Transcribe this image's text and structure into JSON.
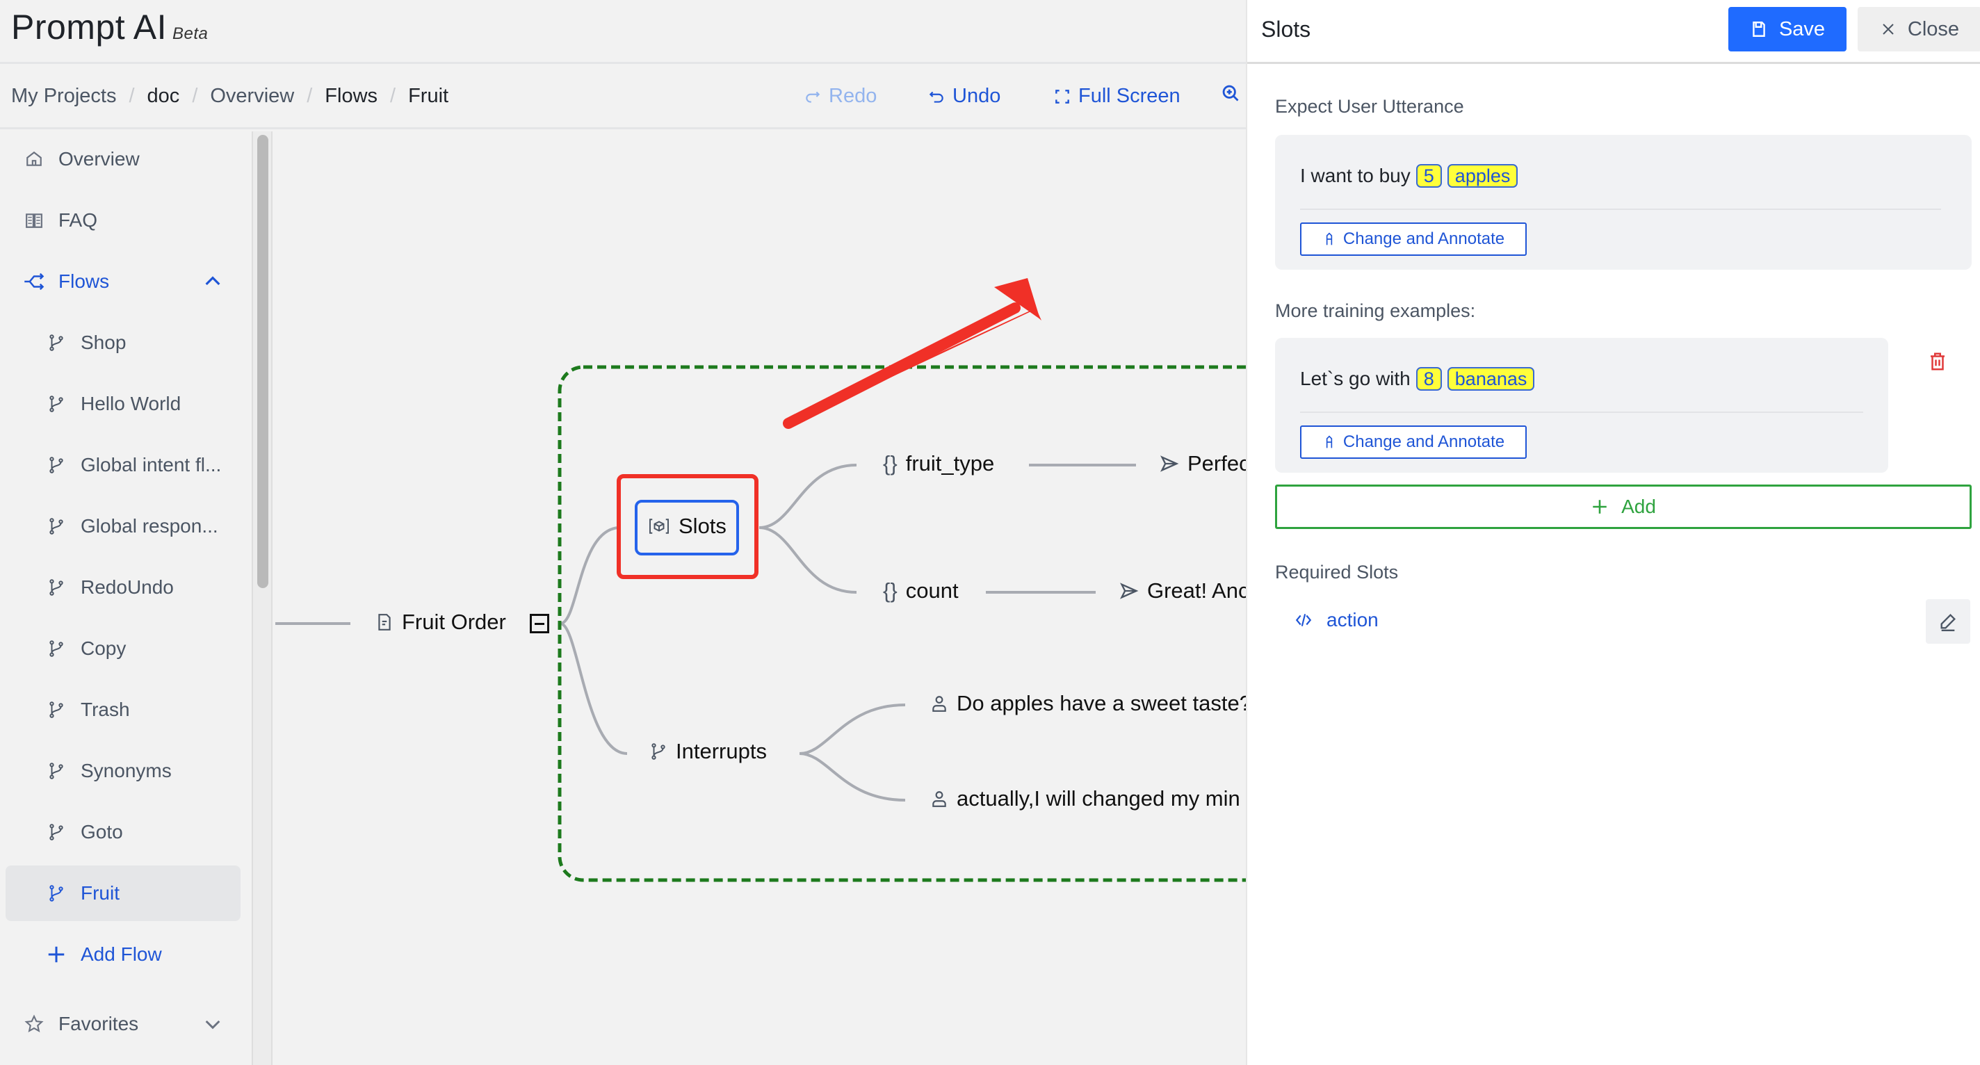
{
  "app": {
    "title": "Prompt AI",
    "badge": "Beta"
  },
  "breadcrumb": [
    "My Projects",
    "doc",
    "Overview",
    "Flows",
    "Fruit"
  ],
  "toolbar": {
    "redo": "Redo",
    "undo": "Undo",
    "fullscreen": "Full Screen",
    "zoom_icon": "zoom-in-icon"
  },
  "sidebar": {
    "overview": "Overview",
    "faq": "FAQ",
    "flows": "Flows",
    "flow_items": [
      "Shop",
      "Hello World",
      "Global intent fl...",
      "Global respon...",
      "RedoUndo",
      "Copy",
      "Trash",
      "Synonyms",
      "Goto",
      "Fruit"
    ],
    "active_flow": "Fruit",
    "add_flow": "Add Flow",
    "favorites": "Favorites"
  },
  "canvas": {
    "root": "Fruit Order",
    "slots_node": "Slots",
    "slot_children": [
      {
        "name": "fruit_type",
        "response": "Perfec"
      },
      {
        "name": "count",
        "response": "Great! Anc"
      }
    ],
    "interrupts": "Interrupts",
    "interrupt_children": [
      "Do apples have a sweet taste?",
      "actually,I will changed my min"
    ]
  },
  "colors": {
    "accent": "#1f55d6",
    "save": "#1f6bff",
    "highlight_box": "#f03027",
    "group_border": "#1d7a1d",
    "add_green": "#2fa33f",
    "tag_bg": "#ffff3a",
    "danger": "#e03a3a"
  },
  "panel": {
    "title": "Slots",
    "save": "Save",
    "close": "Close",
    "expect_label": "Expect User Utterance",
    "expect": {
      "prefix": "I want to buy",
      "tags": [
        "5",
        "apples"
      ]
    },
    "annotate": "Change and Annotate",
    "more_label": "More training examples:",
    "examples": [
      {
        "prefix": "Let`s go with",
        "tags": [
          "8",
          "bananas"
        ]
      }
    ],
    "add": "Add",
    "required_label": "Required Slots",
    "required": [
      "action"
    ]
  }
}
